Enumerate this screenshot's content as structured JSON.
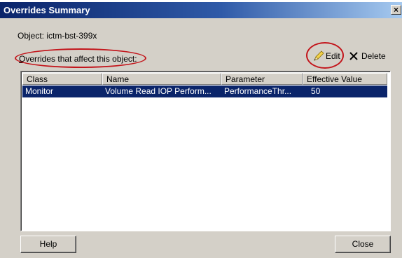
{
  "window": {
    "title": "Overrides Summary",
    "close_glyph": "✕"
  },
  "object_label": "Object: ictm-bst-399x",
  "overrides_label": {
    "first_letter": "O",
    "rest": "verrides that affect this object:"
  },
  "toolbar": {
    "edit_label": "Edit",
    "edit_icon": "pencil-icon",
    "delete_label": "Delete",
    "delete_icon": "x-icon"
  },
  "table": {
    "columns": [
      "Class",
      "Name",
      "Parameter",
      "Effective Value"
    ],
    "rows": [
      {
        "class": "Monitor",
        "name": "Volume Read IOP Perform...",
        "parameter": "PerformanceThr...",
        "value": "50",
        "selected": true
      }
    ]
  },
  "buttons": {
    "help": "Help",
    "close": "Close"
  },
  "colors": {
    "selection": "#0a246a",
    "highlight": "#c3161c",
    "dialog_bg": "#d4d0c8"
  }
}
